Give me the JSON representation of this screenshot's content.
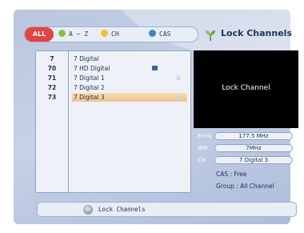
{
  "header": {
    "title": "Lock Channels",
    "filters": [
      {
        "label": "ALL",
        "color": "#e34545"
      },
      {
        "label": "A ~ Z",
        "color": "#86c24a"
      },
      {
        "label": "CH",
        "color": "#f1c232"
      },
      {
        "label": "CAS",
        "color": "#3d85c6"
      }
    ]
  },
  "channels": [
    {
      "number": "7",
      "name": "7 Digital"
    },
    {
      "number": "70",
      "name": "7 HD Digital",
      "icon": "hd-icon"
    },
    {
      "number": "71",
      "name": "7 Digital 1",
      "icon": "lock-icon"
    },
    {
      "number": "72",
      "name": "7 Digital 2"
    },
    {
      "number": "73",
      "name": "7 Digital 3",
      "icon": "lock-icon",
      "selected": true
    }
  ],
  "preview": {
    "text": "Lock Channel"
  },
  "info": {
    "freq_label": "Freq",
    "freq_value": "177.5 MHz",
    "bw_label": "BW",
    "bw_value": "7MHz",
    "ch_label": "Ch",
    "ch_value": "7 Digital 3",
    "cas": "CAS : Free",
    "group": "Group : All Channel"
  },
  "footer": {
    "ok_label": "OK",
    "label": "Lock Channels"
  }
}
